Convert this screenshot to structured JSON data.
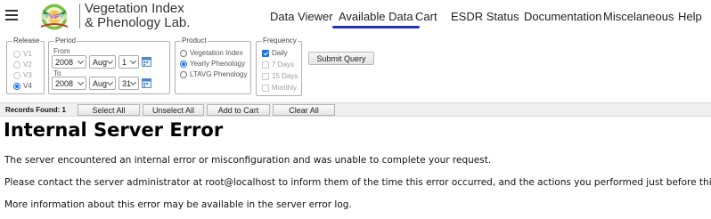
{
  "header": {
    "brand_line1": "Vegetation Index",
    "brand_line2": "& Phenology Lab.",
    "nav": [
      {
        "label": "Data Viewer",
        "active": false
      },
      {
        "label": "Available Data",
        "active": true
      },
      {
        "label": "Cart",
        "active": false
      },
      {
        "label": "ESDR Status",
        "active": false
      },
      {
        "label": "Documentation",
        "active": false
      },
      {
        "label": "Miscelaneous",
        "active": false
      },
      {
        "label": "Help",
        "active": false
      }
    ],
    "accent_color": "#2233b8"
  },
  "form": {
    "release": {
      "legend": "Release",
      "options": [
        {
          "label": "V1",
          "checked": false,
          "disabled": true
        },
        {
          "label": "V2",
          "checked": false,
          "disabled": true
        },
        {
          "label": "V3",
          "checked": false,
          "disabled": true
        },
        {
          "label": "V4",
          "checked": true,
          "disabled": false
        }
      ]
    },
    "period": {
      "legend": "Period",
      "from_label": "From",
      "to_label": "To",
      "from": {
        "year": "2008",
        "month": "Aug",
        "day": "1"
      },
      "to": {
        "year": "2008",
        "month": "Aug",
        "day": "31"
      }
    },
    "product": {
      "legend": "Product",
      "options": [
        {
          "label": "Vegetation Index",
          "checked": false
        },
        {
          "label": "Yearly Phenology",
          "checked": true
        },
        {
          "label": "LTAVG Phenology",
          "checked": false
        }
      ]
    },
    "frequency": {
      "legend": "Frequency",
      "options": [
        {
          "label": "Daily",
          "checked": true,
          "disabled": false
        },
        {
          "label": "7 Days",
          "checked": false,
          "disabled": true
        },
        {
          "label": "15 Days",
          "checked": false,
          "disabled": true
        },
        {
          "label": "Monthly",
          "checked": false,
          "disabled": true
        }
      ]
    },
    "submit_label": "Submit Query"
  },
  "records": {
    "label": "Records Found: 1",
    "buttons": [
      "Select All",
      "Unselect All",
      "Add to Cart",
      "Clear All"
    ]
  },
  "error": {
    "title": "Internal Server Error",
    "p1": "The server encountered an internal error or misconfiguration and was unable to complete your request.",
    "p2": "Please contact the server administrator at root@localhost to inform them of the time this error occurred, and the actions you performed just before this error.",
    "p3": "More information about this error may be available in the server error log."
  }
}
